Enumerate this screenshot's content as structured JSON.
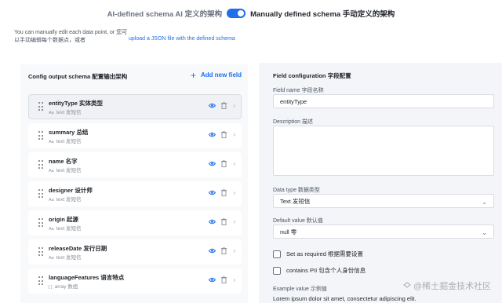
{
  "mode_toggle": {
    "left_label": "AI-defined schema AI 定义的架构",
    "right_label": "Manually defined schema 手动定义的架构",
    "active": "right"
  },
  "help": {
    "text": "You can manually edit each data point, or 您可以手动编辑每个数据点，或者",
    "link": "upload a JSON file with the defined schema"
  },
  "left": {
    "title": "Config output schema 配置输出架构",
    "add_label": "Add new field",
    "fields": [
      {
        "name": "entityType 实体类型",
        "type": "text 发短信",
        "type_icon": "Aa"
      },
      {
        "name": "summary 总结",
        "type": "text 发短信",
        "type_icon": "Aa"
      },
      {
        "name": "name 名字",
        "type": "text 发短信",
        "type_icon": "Aa"
      },
      {
        "name": "designer 设计师",
        "type": "text 发短信",
        "type_icon": "Aa"
      },
      {
        "name": "origin 起源",
        "type": "text 发短信",
        "type_icon": "Aa"
      },
      {
        "name": "releaseDate 发行日期",
        "type": "text 发短信",
        "type_icon": "Aa"
      },
      {
        "name": "languageFeatures 语言特点",
        "type": "array 数组",
        "type_icon": "[ ]"
      }
    ]
  },
  "right": {
    "title": "Field configuration 字段配置",
    "field_name_label": "Field name 字段名称",
    "field_name_value": "entityType",
    "description_label": "Description 描述",
    "description_value": "",
    "data_type_label": "Data type 数据类型",
    "data_type_value": "Text 发短信",
    "default_label": "Default value 默认值",
    "default_value": "null 零",
    "required_label": "Set as required 根据需要设置",
    "pii_label": "contains PII 包含个人身份信息",
    "example_label": "Example value 示例值",
    "example_value": "Lorem ipsum dolor sit amet, consectetur adipiscing elit."
  },
  "watermark": "@稀土掘金技术社区",
  "colors": {
    "accent": "#1f6feb",
    "panel": "#f4f5f8"
  }
}
